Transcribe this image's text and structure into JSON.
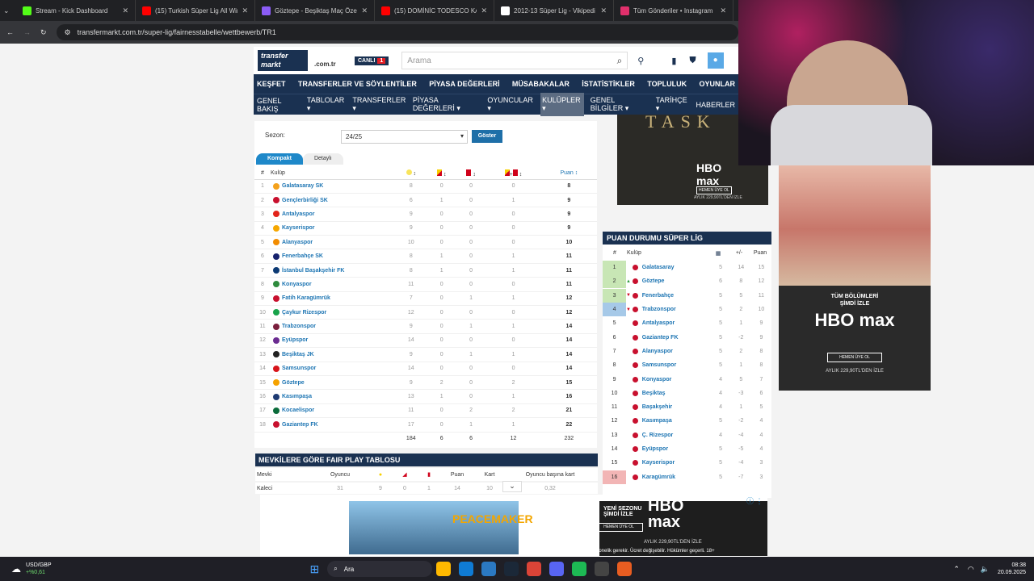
{
  "browser": {
    "tabs": [
      {
        "title": "Stream - Kick Dashboard",
        "color": "#53fc18"
      },
      {
        "title": "(15) Turkish Süper Lig All Winn",
        "color": "#ff0000"
      },
      {
        "title": "Göztepe - Beşiktaş Maç Özeti (",
        "color": "#8b5cf6"
      },
      {
        "title": "(15) DOMİNİC TODESCO KAPTA",
        "color": "#ff0000"
      },
      {
        "title": "2012-13 Süper Lig - Vikipedi",
        "color": "#ffffff"
      },
      {
        "title": "Tüm Gönderiler • Instagram",
        "color": "#e1306c"
      }
    ],
    "url": "transfermarkt.com.tr/super-lig/fairnesstabelle/wettbewerb/TR1"
  },
  "header": {
    "logo_line1": "transfer",
    "logo_line2": "markt",
    "logo_domain": ".com.tr",
    "live_label": "CANLI",
    "live_count": "1",
    "search_placeholder": "Arama"
  },
  "nav_main": [
    "KEŞFET",
    "TRANSFERLER VE SÖYLENTİLER",
    "PİYASA DEĞERLERİ",
    "MÜSABAKALAR",
    "İSTATİSTİKLER",
    "TOPLULUK",
    "OYUNLAR"
  ],
  "nav_sub": [
    "GENEL BAKIŞ",
    "TABLOLAR ▾",
    "TRANSFERLER ▾",
    "PİYASA DEĞERLERİ ▾",
    "OYUNCULAR ▾",
    "KULÜPLER ▾",
    "GENEL BİLGİLER ▾",
    "TARİHÇE ▾",
    "HABERLER"
  ],
  "filter": {
    "season_label": "Sezon:",
    "season_value": "24/25",
    "button": "Göster"
  },
  "view_tabs": {
    "compact": "Kompakt",
    "detailed": "Detaylı"
  },
  "table": {
    "headers": {
      "rank": "#",
      "club": "Kulüp",
      "points": "Puan ↕"
    },
    "rows": [
      {
        "r": "1",
        "club": "Galatasaray SK",
        "y": "8",
        "yr": "0",
        "red": "0",
        "yy": "0",
        "pts": "8",
        "col": "#f4a11c"
      },
      {
        "r": "2",
        "club": "Gençlerbirliği SK",
        "y": "6",
        "yr": "1",
        "red": "0",
        "yy": "1",
        "pts": "9",
        "col": "#c8102e"
      },
      {
        "r": "3",
        "club": "Antalyaspor",
        "y": "9",
        "yr": "0",
        "red": "0",
        "yy": "0",
        "pts": "9",
        "col": "#e2231a"
      },
      {
        "r": "4",
        "club": "Kayserispor",
        "y": "9",
        "yr": "0",
        "red": "0",
        "yy": "0",
        "pts": "9",
        "col": "#f6a700"
      },
      {
        "r": "5",
        "club": "Alanyaspor",
        "y": "10",
        "yr": "0",
        "red": "0",
        "yy": "0",
        "pts": "10",
        "col": "#f28c00"
      },
      {
        "r": "6",
        "club": "Fenerbahçe SK",
        "y": "8",
        "yr": "1",
        "red": "0",
        "yy": "1",
        "pts": "11",
        "col": "#16226d"
      },
      {
        "r": "7",
        "club": "İstanbul Başakşehir FK",
        "y": "8",
        "yr": "1",
        "red": "0",
        "yy": "1",
        "pts": "11",
        "col": "#0c3a74"
      },
      {
        "r": "8",
        "club": "Konyaspor",
        "y": "11",
        "yr": "0",
        "red": "0",
        "yy": "0",
        "pts": "11",
        "col": "#2e8b3d"
      },
      {
        "r": "9",
        "club": "Fatih Karagümrük",
        "y": "7",
        "yr": "0",
        "red": "1",
        "yy": "1",
        "pts": "12",
        "col": "#c8102e"
      },
      {
        "r": "10",
        "club": "Çaykur Rizespor",
        "y": "12",
        "yr": "0",
        "red": "0",
        "yy": "0",
        "pts": "12",
        "col": "#17a34a"
      },
      {
        "r": "11",
        "club": "Trabzonspor",
        "y": "9",
        "yr": "0",
        "red": "1",
        "yy": "1",
        "pts": "14",
        "col": "#7a1f3d"
      },
      {
        "r": "12",
        "club": "Eyüpspor",
        "y": "14",
        "yr": "0",
        "red": "0",
        "yy": "0",
        "pts": "14",
        "col": "#6b2c91"
      },
      {
        "r": "13",
        "club": "Beşiktaş JK",
        "y": "9",
        "yr": "0",
        "red": "1",
        "yy": "1",
        "pts": "14",
        "col": "#222222"
      },
      {
        "r": "14",
        "club": "Samsunspor",
        "y": "14",
        "yr": "0",
        "red": "0",
        "yy": "0",
        "pts": "14",
        "col": "#d7141a"
      },
      {
        "r": "15",
        "club": "Göztepe",
        "y": "9",
        "yr": "2",
        "red": "0",
        "yy": "2",
        "pts": "15",
        "col": "#f5a200"
      },
      {
        "r": "16",
        "club": "Kasımpaşa",
        "y": "13",
        "yr": "1",
        "red": "0",
        "yy": "1",
        "pts": "16",
        "col": "#1f3b73"
      },
      {
        "r": "17",
        "club": "Kocaelispor",
        "y": "11",
        "yr": "0",
        "red": "2",
        "yy": "2",
        "pts": "21",
        "col": "#0a6b3a"
      },
      {
        "r": "18",
        "club": "Gaziantep FK",
        "y": "17",
        "yr": "0",
        "red": "1",
        "yy": "1",
        "pts": "22",
        "col": "#c8102e"
      }
    ],
    "totals": {
      "y": "184",
      "yr": "6",
      "red": "6",
      "yy": "12",
      "pts": "232"
    }
  },
  "fairplay_section": {
    "title": "MEVKİLERE GÖRE FAIR PLAY TABLOSU",
    "headers": [
      "Mevki",
      "Oyuncu",
      "Puan",
      "Kart",
      "Oyuncu başına kart"
    ],
    "row": {
      "pos": "Kaleci",
      "players": "31",
      "y": "9",
      "yr": "0",
      "red": "1",
      "pts": "14",
      "cards": "10",
      "per": "0,32"
    }
  },
  "standings": {
    "title": "PUAN DURUMU SÜPER LİG",
    "headers": {
      "rank": "#",
      "club": "Kulüp",
      "diff": "+/-",
      "pts": "Puan"
    },
    "rows": [
      {
        "r": "1",
        "club": "Galatasaray",
        "p": "5",
        "d": "14",
        "pts": "15",
        "bg": "#c8e6b5",
        "mv": ""
      },
      {
        "r": "2",
        "club": "Göztepe",
        "p": "6",
        "d": "8",
        "pts": "12",
        "bg": "#c8e6b5",
        "mv": "▲"
      },
      {
        "r": "3",
        "club": "Fenerbahçe",
        "p": "5",
        "d": "5",
        "pts": "11",
        "bg": "#c8e6b5",
        "mv": "▼"
      },
      {
        "r": "4",
        "club": "Trabzonspor",
        "p": "5",
        "d": "2",
        "pts": "10",
        "bg": "#a6c9e8",
        "mv": "▼"
      },
      {
        "r": "5",
        "club": "Antalyaspor",
        "p": "5",
        "d": "1",
        "pts": "9",
        "bg": "",
        "mv": ""
      },
      {
        "r": "6",
        "club": "Gaziantep FK",
        "p": "5",
        "d": "-2",
        "pts": "9",
        "bg": "",
        "mv": ""
      },
      {
        "r": "7",
        "club": "Alanyaspor",
        "p": "5",
        "d": "2",
        "pts": "8",
        "bg": "",
        "mv": ""
      },
      {
        "r": "8",
        "club": "Samsunspor",
        "p": "5",
        "d": "1",
        "pts": "8",
        "bg": "",
        "mv": ""
      },
      {
        "r": "9",
        "club": "Konyaspor",
        "p": "4",
        "d": "5",
        "pts": "7",
        "bg": "",
        "mv": ""
      },
      {
        "r": "10",
        "club": "Beşiktaş",
        "p": "4",
        "d": "-3",
        "pts": "6",
        "bg": "",
        "mv": ""
      },
      {
        "r": "11",
        "club": "Başakşehir",
        "p": "4",
        "d": "1",
        "pts": "5",
        "bg": "",
        "mv": ""
      },
      {
        "r": "12",
        "club": "Kasımpaşa",
        "p": "5",
        "d": "-2",
        "pts": "4",
        "bg": "",
        "mv": ""
      },
      {
        "r": "13",
        "club": "Ç. Rizespor",
        "p": "4",
        "d": "-4",
        "pts": "4",
        "bg": "",
        "mv": ""
      },
      {
        "r": "14",
        "club": "Eyüpspor",
        "p": "5",
        "d": "-5",
        "pts": "4",
        "bg": "",
        "mv": ""
      },
      {
        "r": "15",
        "club": "Kayserispor",
        "p": "5",
        "d": "-4",
        "pts": "3",
        "bg": "",
        "mv": ""
      },
      {
        "r": "16",
        "club": "Karagümrük",
        "p": "5",
        "d": "-7",
        "pts": "3",
        "bg": "#f2b5b5",
        "mv": ""
      }
    ]
  },
  "ads": {
    "top_text": "TASK",
    "top_tag": "HEMEN ÜYE OL",
    "top_price": "AYLIK 229,90TL'DEN İZLE",
    "side_line1": "TÜM BÖLÜMLERİ",
    "side_line2": "ŞİMDİ İZLE",
    "side_brand": "HBO max",
    "side_cta": "HEMEN ÜYE OL",
    "side_price": "AYLIK 229,90TL'DEN İZLE",
    "bottom_title": "PEACEMAKER",
    "bottom_line": "YENİ SEZONU ŞİMDİ İZLE",
    "bottom_cta": "HEMEN ÜYE OL",
    "bottom_price": "AYLIK 229,90TL'DEN İZLE",
    "bottom_note": "Abonelik gerekir. Ücret değişebilir. Hükümler geçerli. 18+"
  },
  "taskbar": {
    "ticker_name": "USD/GBP",
    "ticker_change": "+%0,61",
    "search_label": "Ara",
    "time": "08:38",
    "date": "20.09.2025"
  }
}
